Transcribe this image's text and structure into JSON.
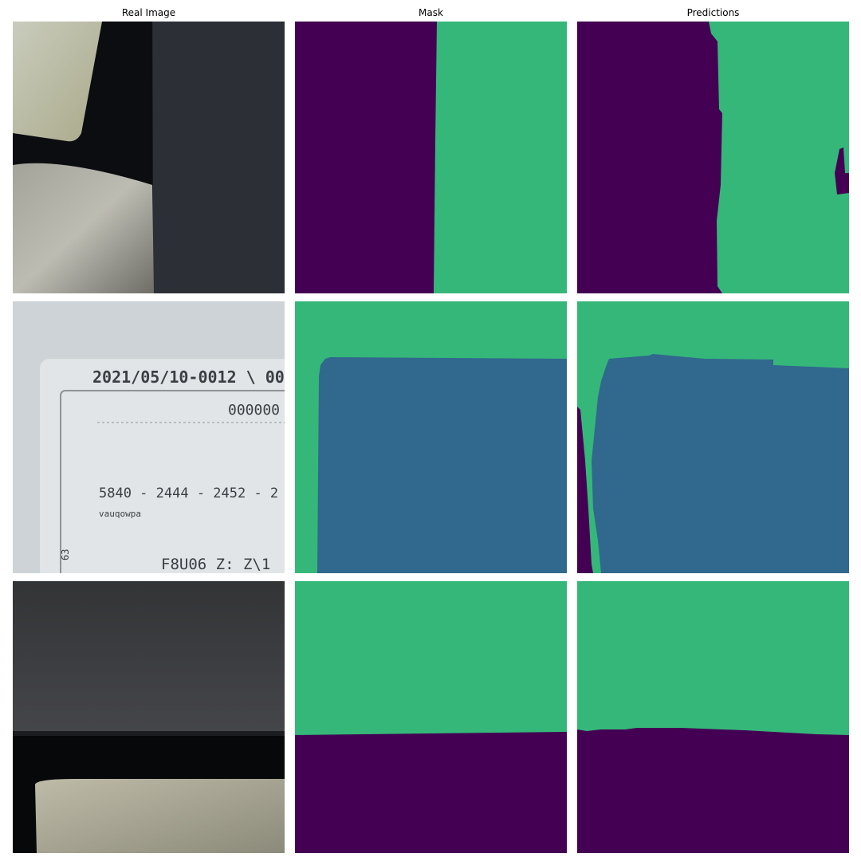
{
  "columns": [
    "Real Image",
    "Mask",
    "Predictions"
  ],
  "card_text": {
    "line1": "2021/05/10-0012 \\ 00",
    "line2": "000000",
    "line3": "5840 - 2444 - 2452 - 2",
    "line4": "vauqowpa",
    "line5": "F8U06 Z: Z\\1",
    "side": "63"
  },
  "colors": {
    "class_dark": "#440154",
    "class_mid": "#31688e",
    "class_light": "#35b779"
  }
}
